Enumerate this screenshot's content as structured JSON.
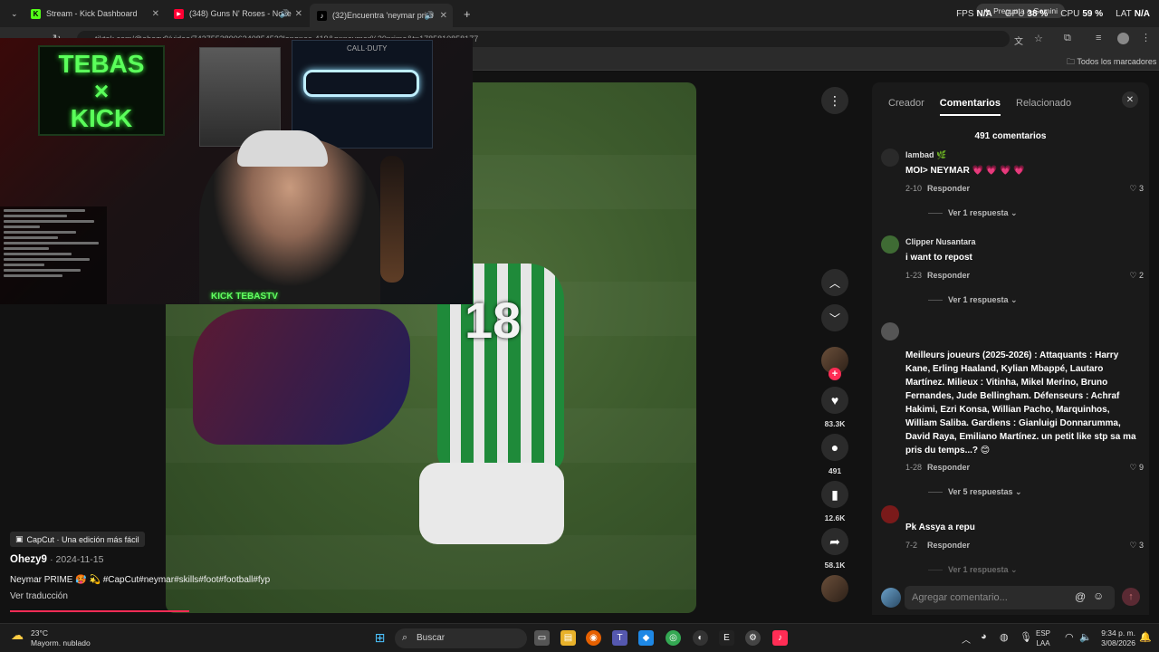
{
  "tabs": [
    {
      "title": "Stream - Kick Dashboard",
      "fav": "K",
      "color": "#53fc18"
    },
    {
      "title": "(348) Guns N' Roses - Nove",
      "fav": "▶",
      "color": "#ff0033"
    },
    {
      "title": "(32)Encuentra 'neymar prim",
      "fav": "♪",
      "color": "#000000"
    }
  ],
  "browser": {
    "url": "tiktok.com/@ohezy9/video/7437552890634085452?lang=es-419&q=neymar%20prime&t=1785810858177",
    "gemini_label": "Pregunta a Gemini",
    "bookmarks_label": "Todos los marcadores"
  },
  "stats": {
    "fps_label": "FPS",
    "fps": "N/A",
    "gpu_label": "GPU",
    "gpu": "38 %",
    "cpu_label": "CPU",
    "cpu": "59 %",
    "lat_label": "LAT",
    "lat": "N/A"
  },
  "webcam": {
    "sign_line1": "TEBAS",
    "sign_line2": "×",
    "sign_line3": "KICK",
    "streamer_tag": "KICK TEBASTV",
    "gun_sign_label": "CALL·DUTY"
  },
  "video": {
    "jersey_number": "18",
    "capcut_label": "CapCut · Una edición más fácil",
    "author": "Ohezy9",
    "date": "· 2024-11-15",
    "caption": "Neymar PRIME 🥵 💫 #CapCut#neymar#skills#foot#football#fyp",
    "translate_label": "Ver traducción",
    "progress": 0.3
  },
  "actions": {
    "likes": "83.3K",
    "comments": "491",
    "saves": "12.6K",
    "shares": "58.1K"
  },
  "panel": {
    "tabs": [
      "Creador",
      "Comentarios",
      "Relacionado"
    ],
    "active_tab": 1,
    "count_label": "491 comentarios",
    "reply_label": "Responder",
    "input_placeholder": "Agregar comentario...",
    "comments": [
      {
        "user": "Iambad 🌿",
        "text": "MOI> NEYMAR 💗 💗 💗 💗",
        "date": "2-10",
        "likes": "3",
        "more": "Ver 1 respuesta ⌄",
        "avatar": "#2a2a2a"
      },
      {
        "user": "Clipper Nusantara",
        "text": "i want to repost",
        "date": "1-23",
        "likes": "2",
        "more": "Ver 1 respuesta ⌄",
        "avatar": "#3f6b34"
      },
      {
        "user": "",
        "text": "Meilleurs joueurs (2025-2026) : Attaquants : Harry Kane, Erling Haaland, Kylian Mbappé, Lautaro Martínez. Milieux : Vitinha, Mikel Merino, Bruno Fernandes, Jude Bellingham. Défenseurs : Achraf Hakimi, Ezri Konsa, Willian Pacho, Marquinhos, William Saliba. Gardiens : Gianluigi Donnarumma, David Raya, Emiliano Martínez. un petit like stp sa ma pris du temps...? 😊",
        "date": "1-28",
        "likes": "9",
        "more": "Ver 5 respuestas ⌄",
        "avatar": "#555555"
      },
      {
        "user": "",
        "text": "Pk Assya a repu",
        "date": "7-2",
        "likes": "3",
        "more": "Ver 1 respuesta ⌄",
        "avatar": "#7a1a1a"
      }
    ]
  },
  "taskbar": {
    "temp": "23°C",
    "weather": "Mayorm. nublado",
    "search": "Buscar",
    "lang_line1": "ESP",
    "lang_line2": "LAA",
    "time": "9:34 p. m.",
    "date": "3/08/2026"
  }
}
